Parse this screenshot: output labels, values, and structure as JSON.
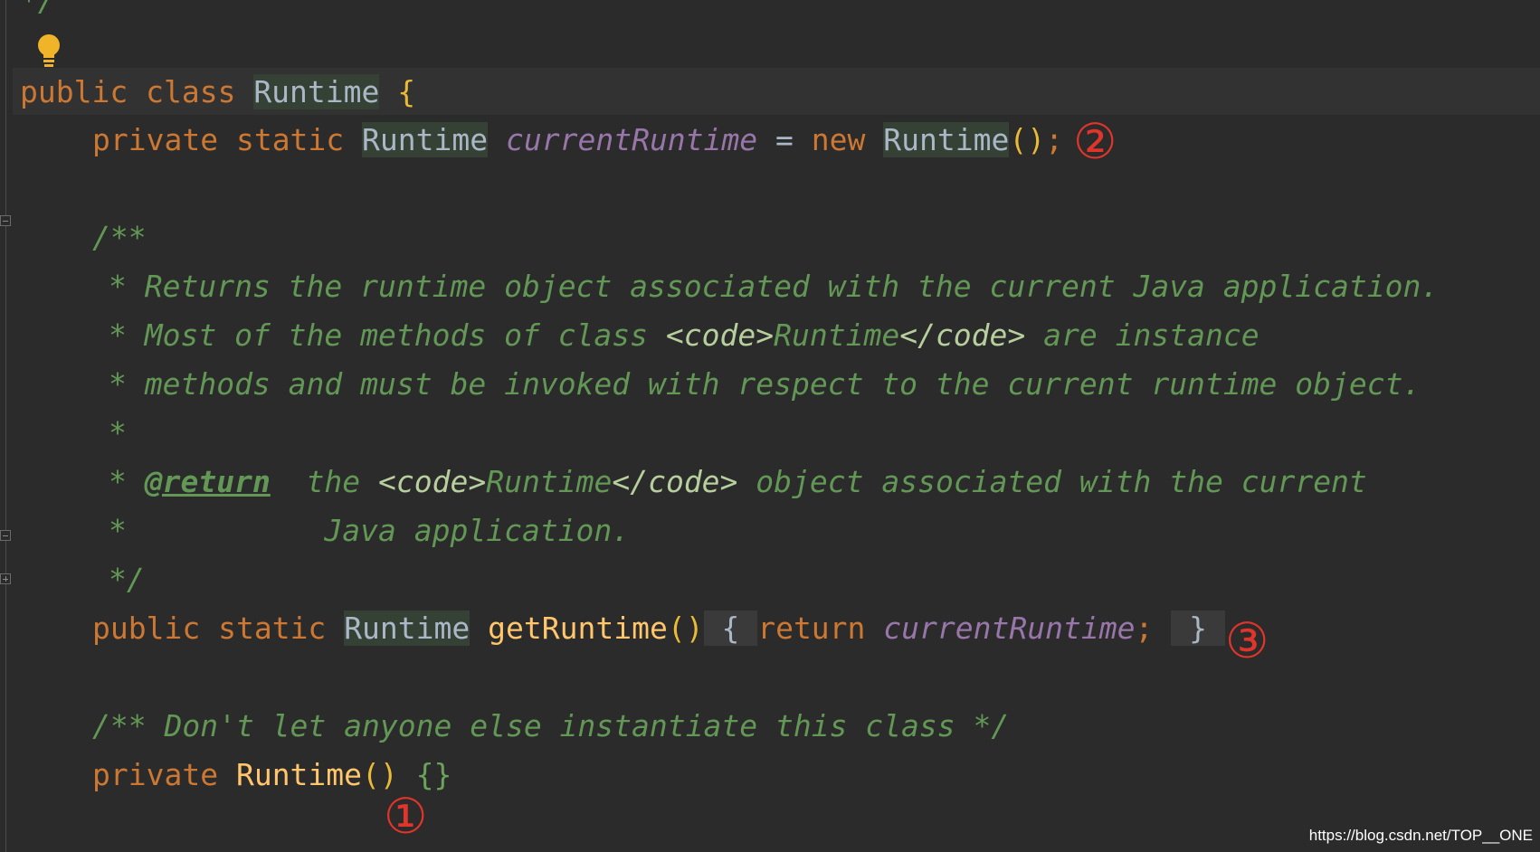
{
  "code": {
    "top_fragment": "*/",
    "line_class": {
      "kw_public": "public",
      "kw_class": "class",
      "class_name": "Runtime",
      "brace": "{"
    },
    "line_field": {
      "kw_private": "private",
      "kw_static": "static",
      "type": "Runtime",
      "field": "currentRuntime",
      "eq": "=",
      "kw_new": "new",
      "ctor": "Runtime",
      "parens": "()",
      "semi": ";"
    },
    "javadoc": {
      "open": "/**",
      "line1": "* Returns the runtime object associated with the current Java application.",
      "line2_a": "* Most of the methods of class ",
      "line2_tag_open": "<code>",
      "line2_word": "Runtime",
      "line2_tag_close": "</code>",
      "line2_b": " are instance",
      "line3": "* methods and must be invoked with respect to the current runtime object.",
      "line4": "*",
      "line5_star": "* ",
      "line5_tag": "@return",
      "line5_a": "  the ",
      "line5_code_open": "<code>",
      "line5_word": "Runtime",
      "line5_code_close": "</code>",
      "line5_b": " object associated with the current",
      "line6": "*           Java application.",
      "close": "*/"
    },
    "line_method": {
      "kw_public": "public",
      "kw_static": "static",
      "type": "Runtime",
      "name": "getRuntime",
      "parens": "()",
      "open": "{",
      "kw_return": "return",
      "field": "currentRuntime",
      "semi": ";",
      "close": "}"
    },
    "line_comment": "/** Don't let anyone else instantiate this class */",
    "line_ctor": {
      "kw_private": "private",
      "name": "Runtime",
      "parens": "()",
      "body": "{}"
    }
  },
  "annotations": {
    "mark_1": "①",
    "mark_2": "②",
    "mark_3": "③"
  },
  "watermark": "https://blog.csdn.net/TOP__ONE",
  "colors": {
    "background": "#2b2b2b",
    "keyword": "#cc7832",
    "field": "#9876aa",
    "function": "#ffc66d",
    "comment": "#629755",
    "annotation_red": "#e0352b"
  },
  "icons": {
    "intention": "lightbulb-icon"
  }
}
